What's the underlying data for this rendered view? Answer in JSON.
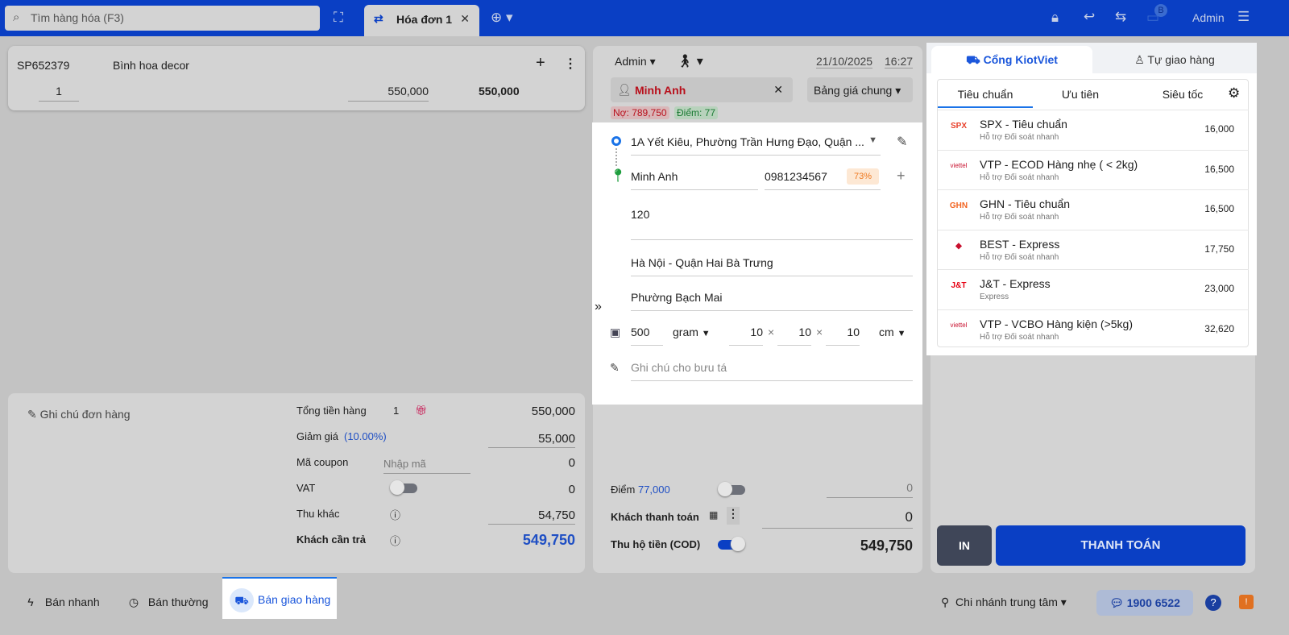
{
  "header": {
    "search_placeholder": "Tìm hàng hóa (F3)",
    "invoice_tab": "Hóa đơn 1",
    "badge": "B",
    "user": "Admin"
  },
  "cart": {
    "code": "SP652379",
    "name": "Bình hoa decor",
    "qty": "1",
    "price": "550,000",
    "total": "550,000"
  },
  "summary": {
    "note": "Ghi chú đơn hàng",
    "subtotal_label": "Tổng tiền hàng",
    "subtotal_qty": "1",
    "subtotal": "550,000",
    "discount_label": "Giảm giá",
    "discount_pct": "(10.00%)",
    "discount": "55,000",
    "coupon_label": "Mã coupon",
    "coupon_placeholder": "Nhập mã",
    "coupon_value": "0",
    "vat_label": "VAT",
    "vat": "0",
    "other_label": "Thu khác",
    "other": "54,750",
    "need_pay_label": "Khách cần trả",
    "need_pay": "549,750"
  },
  "order": {
    "seller": "Admin",
    "date": "21/10/2025",
    "time": "16:27",
    "customer": "Minh Anh",
    "price_list": "Bảng giá chung",
    "debt": "Nợ: 789,750",
    "points": "Điểm: 77"
  },
  "delivery": {
    "address": "1A Yết Kiêu, Phường Trần Hưng Đạo, Quận ...",
    "receiver": "Minh Anh",
    "phone": "0981234567",
    "success_rate": "73%",
    "street": "120",
    "city": "Hà Nội - Quận Hai Bà Trưng",
    "ward": "Phường Bạch Mai",
    "weight": "500",
    "weight_unit": "gram",
    "length": "10",
    "width": "10",
    "height": "10",
    "size_unit": "cm",
    "times": "×",
    "note_placeholder": "Ghi chú cho bưu tá"
  },
  "payment": {
    "points_label": "Điểm",
    "points_value": "77,000",
    "points_input": "0",
    "customer_pay_label": "Khách thanh toán",
    "customer_pay": "0",
    "cod_label": "Thu hộ tiền (COD)",
    "cod_amount": "549,750",
    "cod_on": true,
    "points_on": false
  },
  "shipping": {
    "tab_gateway": "Cổng KiotViet",
    "tab_self": "Tự giao hàng",
    "subtabs": [
      "Tiêu chuẩn",
      "Ưu tiên",
      "Siêu tốc"
    ],
    "carriers": [
      {
        "logo": "SPX",
        "name": "SPX - Tiêu chuẩn",
        "sub": "Hỗ trợ Đối soát nhanh",
        "price": "16,000",
        "color": "#e8412c"
      },
      {
        "logo": "viettel",
        "name": "VTP - ECOD Hàng nhẹ ( < 2kg)",
        "sub": "Hỗ trợ Đối soát nhanh",
        "price": "16,500",
        "color": "#c8102e"
      },
      {
        "logo": "GHN",
        "name": "GHN - Tiêu chuẩn",
        "sub": "Hỗ trợ Đối soát nhanh",
        "price": "16,500",
        "color": "#f26522"
      },
      {
        "logo": "◆",
        "name": "BEST - Express",
        "sub": "Hỗ trợ Đối soát nhanh",
        "price": "17,750",
        "color": "#c8102e"
      },
      {
        "logo": "J&T",
        "name": "J&T - Express",
        "sub": "Express",
        "price": "23,000",
        "color": "#e60012"
      },
      {
        "logo": "viettel",
        "name": "VTP - VCBO Hàng kiện (>5kg)",
        "sub": "Hỗ trợ Đối soát nhanh",
        "price": "32,620",
        "color": "#c8102e"
      }
    ]
  },
  "actions": {
    "print": "IN",
    "pay": "THANH TOÁN"
  },
  "footer": {
    "quick": "Bán nhanh",
    "normal": "Bán thường",
    "delivery": "Bán giao hàng",
    "branch": "Chi nhánh trung tâm",
    "hotline": "1900 6522"
  }
}
